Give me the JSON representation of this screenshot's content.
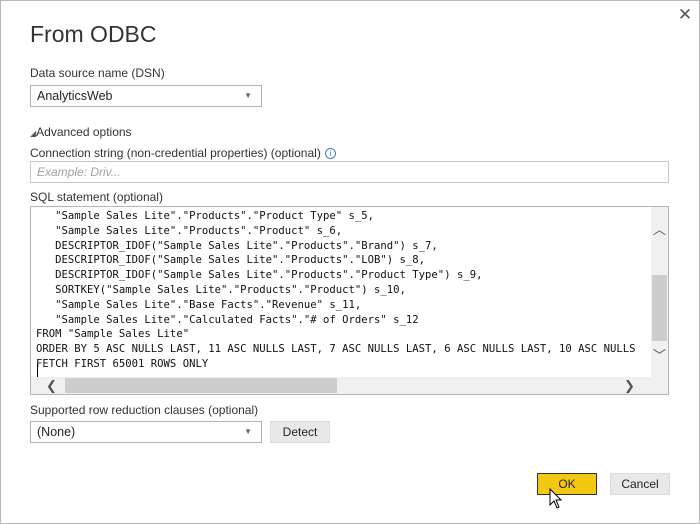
{
  "dialog": {
    "title": "From ODBC",
    "close_icon": "close-icon"
  },
  "dsn": {
    "label": "Data source name (DSN)",
    "value": "AnalyticsWeb"
  },
  "advanced": {
    "toggle_label": "Advanced options",
    "toggle_glyph": "◢"
  },
  "connection_string": {
    "label": "Connection string (non-credential properties) (optional)",
    "info_glyph": "i",
    "placeholder": "Example: Driv..."
  },
  "sql": {
    "label": "SQL statement (optional)",
    "lines": [
      "   \"Sample Sales Lite\".\"Products\".\"Product Type\" s_5,",
      "   \"Sample Sales Lite\".\"Products\".\"Product\" s_6,",
      "   DESCRIPTOR_IDOF(\"Sample Sales Lite\".\"Products\".\"Brand\") s_7,",
      "   DESCRIPTOR_IDOF(\"Sample Sales Lite\".\"Products\".\"LOB\") s_8,",
      "   DESCRIPTOR_IDOF(\"Sample Sales Lite\".\"Products\".\"Product Type\") s_9,",
      "   SORTKEY(\"Sample Sales Lite\".\"Products\".\"Product\") s_10,",
      "   \"Sample Sales Lite\".\"Base Facts\".\"Revenue\" s_11,",
      "   \"Sample Sales Lite\".\"Calculated Facts\".\"# of Orders\" s_12",
      "FROM \"Sample Sales Lite\"",
      "ORDER BY 5 ASC NULLS LAST, 11 ASC NULLS LAST, 7 ASC NULLS LAST, 6 ASC NULLS LAST, 10 ASC NULLS",
      "FETCH FIRST 65001 ROWS ONLY"
    ]
  },
  "row_reduction": {
    "label": "Supported row reduction clauses (optional)",
    "value": "(None)",
    "detect_label": "Detect"
  },
  "footer": {
    "ok_label": "OK",
    "cancel_label": "Cancel",
    "ok_color": "#F2C811"
  }
}
